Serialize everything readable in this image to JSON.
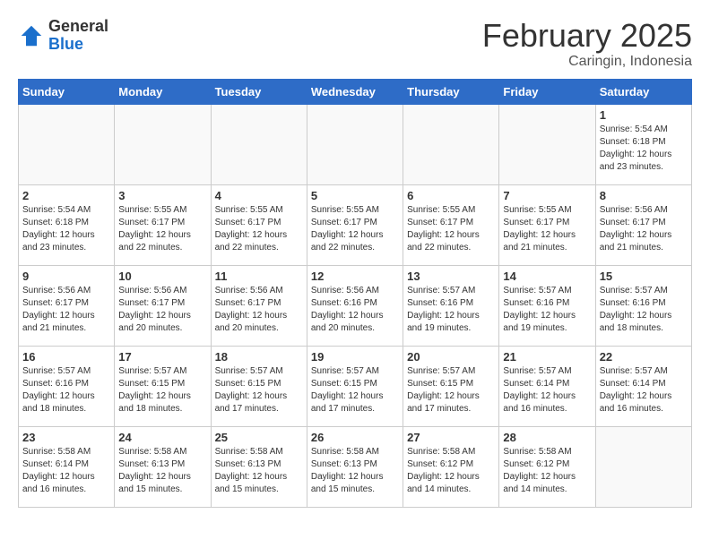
{
  "header": {
    "logo_general": "General",
    "logo_blue": "Blue",
    "month_title": "February 2025",
    "location": "Caringin, Indonesia"
  },
  "weekdays": [
    "Sunday",
    "Monday",
    "Tuesday",
    "Wednesday",
    "Thursday",
    "Friday",
    "Saturday"
  ],
  "weeks": [
    [
      {
        "day": "",
        "info": ""
      },
      {
        "day": "",
        "info": ""
      },
      {
        "day": "",
        "info": ""
      },
      {
        "day": "",
        "info": ""
      },
      {
        "day": "",
        "info": ""
      },
      {
        "day": "",
        "info": ""
      },
      {
        "day": "1",
        "info": "Sunrise: 5:54 AM\nSunset: 6:18 PM\nDaylight: 12 hours\nand 23 minutes."
      }
    ],
    [
      {
        "day": "2",
        "info": "Sunrise: 5:54 AM\nSunset: 6:18 PM\nDaylight: 12 hours\nand 23 minutes."
      },
      {
        "day": "3",
        "info": "Sunrise: 5:55 AM\nSunset: 6:17 PM\nDaylight: 12 hours\nand 22 minutes."
      },
      {
        "day": "4",
        "info": "Sunrise: 5:55 AM\nSunset: 6:17 PM\nDaylight: 12 hours\nand 22 minutes."
      },
      {
        "day": "5",
        "info": "Sunrise: 5:55 AM\nSunset: 6:17 PM\nDaylight: 12 hours\nand 22 minutes."
      },
      {
        "day": "6",
        "info": "Sunrise: 5:55 AM\nSunset: 6:17 PM\nDaylight: 12 hours\nand 22 minutes."
      },
      {
        "day": "7",
        "info": "Sunrise: 5:55 AM\nSunset: 6:17 PM\nDaylight: 12 hours\nand 21 minutes."
      },
      {
        "day": "8",
        "info": "Sunrise: 5:56 AM\nSunset: 6:17 PM\nDaylight: 12 hours\nand 21 minutes."
      }
    ],
    [
      {
        "day": "9",
        "info": "Sunrise: 5:56 AM\nSunset: 6:17 PM\nDaylight: 12 hours\nand 21 minutes."
      },
      {
        "day": "10",
        "info": "Sunrise: 5:56 AM\nSunset: 6:17 PM\nDaylight: 12 hours\nand 20 minutes."
      },
      {
        "day": "11",
        "info": "Sunrise: 5:56 AM\nSunset: 6:17 PM\nDaylight: 12 hours\nand 20 minutes."
      },
      {
        "day": "12",
        "info": "Sunrise: 5:56 AM\nSunset: 6:16 PM\nDaylight: 12 hours\nand 20 minutes."
      },
      {
        "day": "13",
        "info": "Sunrise: 5:57 AM\nSunset: 6:16 PM\nDaylight: 12 hours\nand 19 minutes."
      },
      {
        "day": "14",
        "info": "Sunrise: 5:57 AM\nSunset: 6:16 PM\nDaylight: 12 hours\nand 19 minutes."
      },
      {
        "day": "15",
        "info": "Sunrise: 5:57 AM\nSunset: 6:16 PM\nDaylight: 12 hours\nand 18 minutes."
      }
    ],
    [
      {
        "day": "16",
        "info": "Sunrise: 5:57 AM\nSunset: 6:16 PM\nDaylight: 12 hours\nand 18 minutes."
      },
      {
        "day": "17",
        "info": "Sunrise: 5:57 AM\nSunset: 6:15 PM\nDaylight: 12 hours\nand 18 minutes."
      },
      {
        "day": "18",
        "info": "Sunrise: 5:57 AM\nSunset: 6:15 PM\nDaylight: 12 hours\nand 17 minutes."
      },
      {
        "day": "19",
        "info": "Sunrise: 5:57 AM\nSunset: 6:15 PM\nDaylight: 12 hours\nand 17 minutes."
      },
      {
        "day": "20",
        "info": "Sunrise: 5:57 AM\nSunset: 6:15 PM\nDaylight: 12 hours\nand 17 minutes."
      },
      {
        "day": "21",
        "info": "Sunrise: 5:57 AM\nSunset: 6:14 PM\nDaylight: 12 hours\nand 16 minutes."
      },
      {
        "day": "22",
        "info": "Sunrise: 5:57 AM\nSunset: 6:14 PM\nDaylight: 12 hours\nand 16 minutes."
      }
    ],
    [
      {
        "day": "23",
        "info": "Sunrise: 5:58 AM\nSunset: 6:14 PM\nDaylight: 12 hours\nand 16 minutes."
      },
      {
        "day": "24",
        "info": "Sunrise: 5:58 AM\nSunset: 6:13 PM\nDaylight: 12 hours\nand 15 minutes."
      },
      {
        "day": "25",
        "info": "Sunrise: 5:58 AM\nSunset: 6:13 PM\nDaylight: 12 hours\nand 15 minutes."
      },
      {
        "day": "26",
        "info": "Sunrise: 5:58 AM\nSunset: 6:13 PM\nDaylight: 12 hours\nand 15 minutes."
      },
      {
        "day": "27",
        "info": "Sunrise: 5:58 AM\nSunset: 6:12 PM\nDaylight: 12 hours\nand 14 minutes."
      },
      {
        "day": "28",
        "info": "Sunrise: 5:58 AM\nSunset: 6:12 PM\nDaylight: 12 hours\nand 14 minutes."
      },
      {
        "day": "",
        "info": ""
      }
    ]
  ]
}
